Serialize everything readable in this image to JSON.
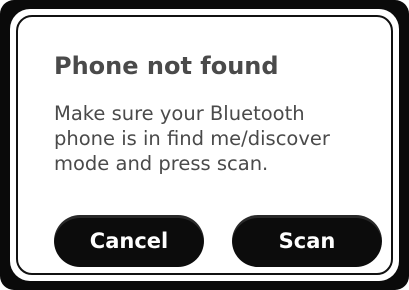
{
  "dialog": {
    "title": "Phone not found",
    "message_lines": [
      "Make sure your Bluetooth",
      "phone is in find me/discover",
      "mode and press scan."
    ]
  },
  "buttons": {
    "cancel_label": "Cancel",
    "scan_label": "Scan"
  },
  "colors": {
    "frame": "#0a0a0a",
    "dialog_background": "#ffffff",
    "text": "#4a4a4a",
    "button_background": "#0c0c0c",
    "button_text": "#ffffff"
  }
}
